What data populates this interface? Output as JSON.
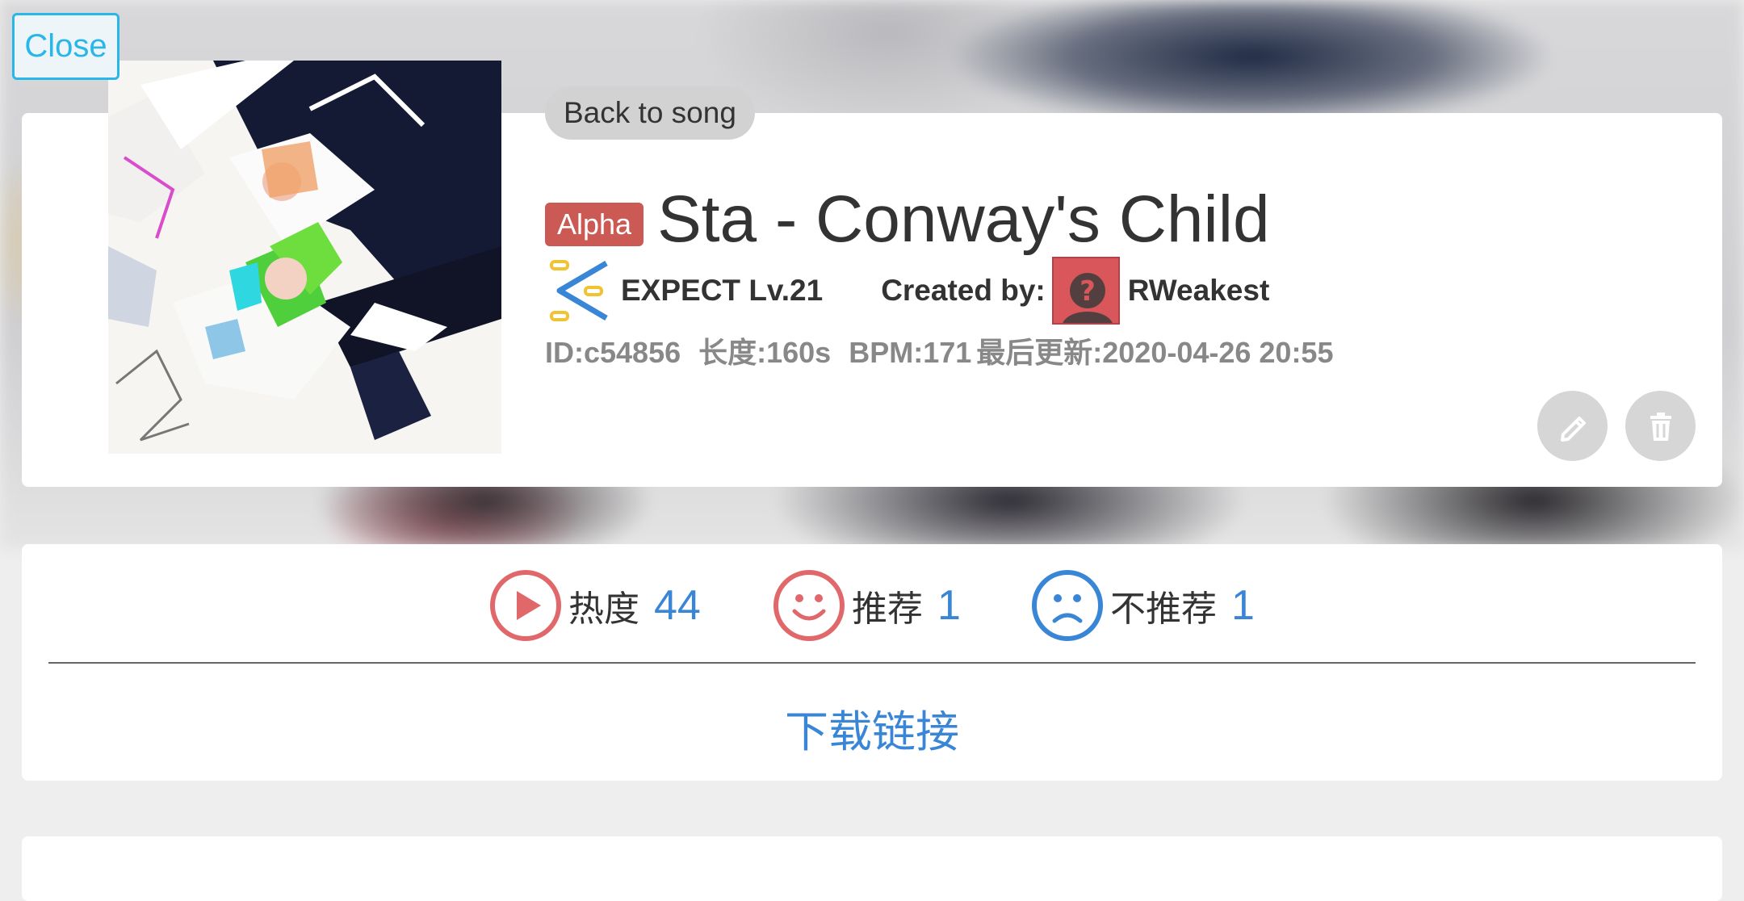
{
  "close_label": "Close",
  "back_label": "Back to song",
  "song": {
    "badge": "Alpha",
    "title": "Sta - Conway's Child",
    "difficulty": "EXPECT Lv.21",
    "created_by_label": "Created by:",
    "creator": "RWeakest",
    "id": "ID:c54856",
    "length": "长度:160s",
    "bpm": "BPM:171",
    "updated": "最后更新:2020-04-26 20:55"
  },
  "stats": {
    "views_label": "热度",
    "views_value": "44",
    "recommend_label": "推荐",
    "recommend_value": "1",
    "not_recommend_label": "不推荐",
    "not_recommend_value": "1"
  },
  "download_label": "下载链接",
  "colors": {
    "accent_blue": "#3a86d6",
    "close_cyan": "#29b6e9",
    "alpha_red": "#cc5a54",
    "play_red": "#e0686a"
  },
  "icons": [
    "play-icon",
    "smile-icon",
    "frown-icon",
    "edit-icon",
    "trash-icon",
    "expect-difficulty-icon"
  ]
}
